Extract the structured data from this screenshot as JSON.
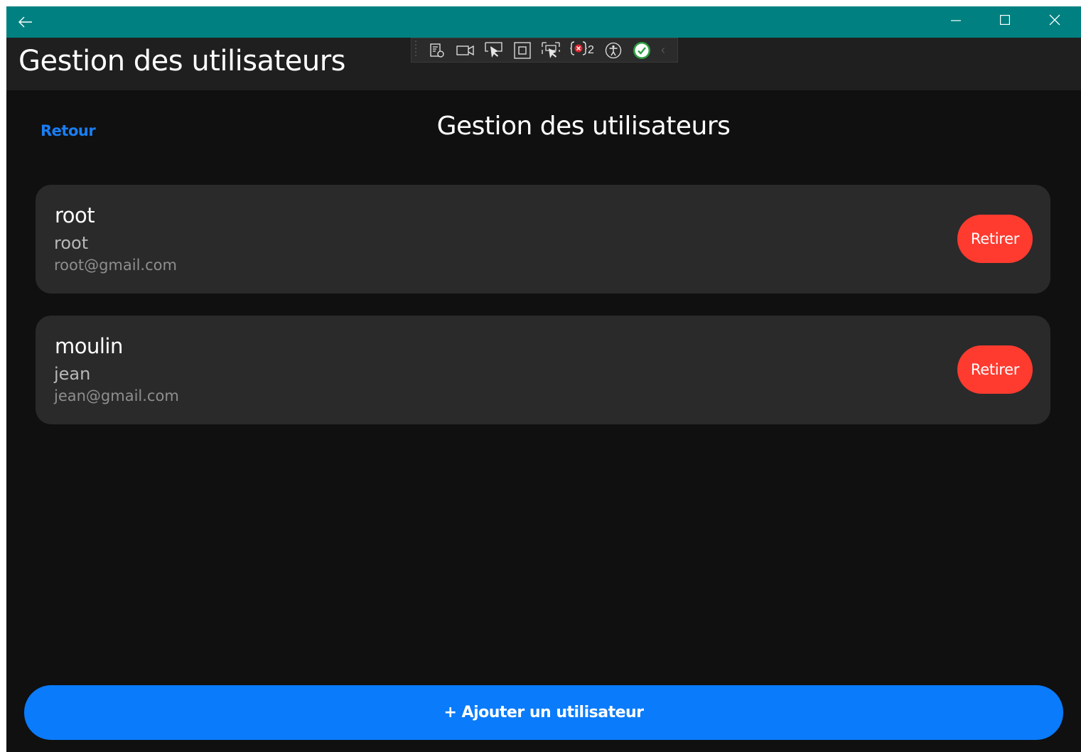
{
  "window": {
    "controls": {
      "minimize_icon": "minimize-icon",
      "maximize_icon": "maximize-icon",
      "close_icon": "close-icon",
      "back_icon": "back-arrow-icon"
    },
    "titlebar_color": "#008080"
  },
  "app_header": {
    "title": "Gestion des utilisateurs"
  },
  "dev_toolbar": {
    "buttons": [
      "live-visual-tree-icon",
      "video-camera-icon",
      "select-element-icon",
      "display-layout-adorners-icon",
      "track-focused-element-icon",
      "binding-failures-icon",
      "accessibility-icon",
      "hot-reload-status-icon"
    ],
    "binding_failures_count": "2"
  },
  "nav": {
    "back_label": "Retour"
  },
  "page": {
    "title": "Gestion des utilisateurs"
  },
  "users": [
    {
      "name": "root",
      "first_name": "root",
      "email": "root@gmail.com",
      "remove_label": "Retirer"
    },
    {
      "name": "moulin",
      "first_name": "jean",
      "email": "jean@gmail.com",
      "remove_label": "Retirer"
    }
  ],
  "actions": {
    "add_user_label": "+ Ajouter un utilisateur"
  },
  "colors": {
    "accent": "#0a7bfa",
    "danger": "#ff3b30",
    "link": "#1a7ef5",
    "background": "#101010",
    "card": "#2a2a2a"
  }
}
